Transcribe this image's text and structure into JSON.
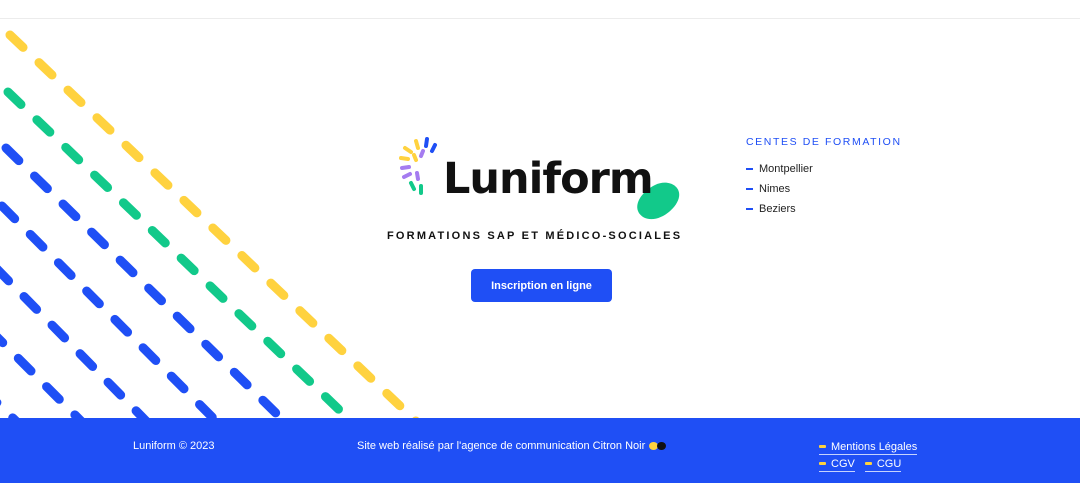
{
  "brand": {
    "name": "Luniform",
    "tagline": "FORMATIONS SAP ET MÉDICO-SOCIALES",
    "cta_label": "Inscription en ligne"
  },
  "centres": {
    "title": "CENTES DE FORMATION",
    "items": [
      "Montpellier",
      "Nimes",
      "Beziers"
    ]
  },
  "footer": {
    "copyright": "Luniform © 2023",
    "credit": "Site web réalisé par l'agence de communication Citron Noir",
    "links": {
      "mentions": "Mentions Légales",
      "cgv": "CGV",
      "cgu": "CGU"
    }
  },
  "colors": {
    "accent_blue": "#1f4ff5",
    "yellow": "#ffd23f",
    "green": "#12c98a",
    "purple": "#a57cf0"
  },
  "icons": [
    "luniform-logo-icon",
    "green-blob-icon",
    "citron-noir-emoji-icon"
  ]
}
